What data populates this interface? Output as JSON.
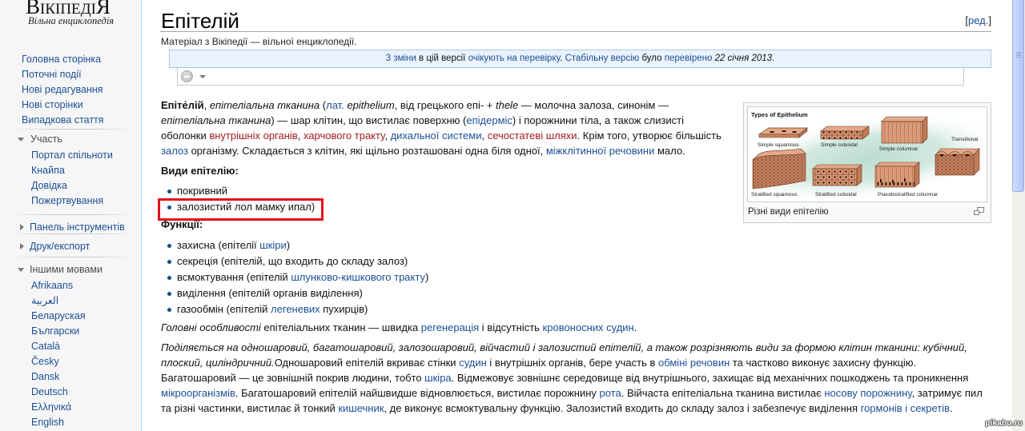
{
  "colors": {
    "link": "#1c4f95",
    "redlink": "#a31c1c",
    "text": "#111111",
    "bullet": "#00528c",
    "annotation": "#e3101b",
    "flagged_bg": "#eaf3fd",
    "flagged_border": "#aac7e6",
    "sidebar_bg": "#f6f6f6"
  },
  "sidebar": {
    "logo": {
      "wordmark": "ВікіпедіЯ",
      "tagline": "Вільна енциклопедія"
    },
    "navigation": [
      "Головна сторінка",
      "Поточні події",
      "Нові редагування",
      "Нові сторінки",
      "Випадкова стаття"
    ],
    "participation": {
      "heading": "Участь",
      "state": "expanded",
      "items": [
        "Портал спільноти",
        "Кнайпа",
        "Довідка",
        "Пожертвування"
      ]
    },
    "toolbox": {
      "heading": "Панель інструментів",
      "state": "collapsed"
    },
    "print": {
      "heading": "Друк/експорт",
      "state": "collapsed"
    },
    "languages": {
      "heading": "Іншими мовами",
      "state": "expanded",
      "items": [
        "Afrikaans",
        "العربية",
        "Беларуская",
        "Български",
        "Català",
        "Česky",
        "Dansk",
        "Deutsch",
        "Ελληνικά",
        "English"
      ]
    }
  },
  "article": {
    "title": "Епітелій",
    "edit_section": {
      "open": "[",
      "label": "ред.",
      "close": "]"
    },
    "site_sub": "Матеріал з Вікіпедії — вільної енциклопедії.",
    "flagged_revs": [
      {
        "type": "link",
        "text": "3 зміни"
      },
      {
        "type": "plain",
        "text": " в цій версії "
      },
      {
        "type": "link",
        "text": "очікують на перевірку"
      },
      {
        "type": "plain",
        "text": ". "
      },
      {
        "type": "link",
        "text": "Стабільну версію"
      },
      {
        "type": "plain",
        "text": " було "
      },
      {
        "type": "link",
        "text": "перевірено"
      },
      {
        "type": "plain",
        "text": " "
      },
      {
        "type": "italic",
        "text": "22 січня 2013"
      },
      {
        "type": "plain",
        "text": "."
      }
    ],
    "feedback_widget": {
      "icons": [
        "disabled-circle-icon",
        "dropdown-arrow-icon"
      ]
    },
    "thumbnail": {
      "caption": "Різні види епітелію",
      "image_title": "Types of Epithelium",
      "labels": {
        "simple_squamous": "Simple squamous",
        "simple_cuboidal": "Simple cuboidal",
        "simple_columnar": "Simple columnar",
        "transitional": "Transitional",
        "stratified_squamous": "Stratified squamous",
        "stratified_cuboidal": "Stratified cuboidal",
        "pseudostratified": "Pseudostratified columnar"
      }
    },
    "intro": [
      {
        "type": "bold",
        "text": "Епіте́лій"
      },
      {
        "type": "plain",
        "text": ", "
      },
      {
        "type": "italic",
        "text": "епітеліальна тканина"
      },
      {
        "type": "plain",
        "text": " ("
      },
      {
        "type": "link",
        "text": "лат."
      },
      {
        "type": "plain",
        "text": " "
      },
      {
        "type": "italic",
        "text": "epithelium"
      },
      {
        "type": "plain",
        "text": ", від грецького епі- + "
      },
      {
        "type": "italic",
        "text": "thele"
      },
      {
        "type": "plain",
        "text": " — молочна залоза, синонім — "
      },
      {
        "type": "italic",
        "text": "епітеліальна тканина"
      },
      {
        "type": "plain",
        "text": ") — шар клітин, що вистилає поверхню ("
      },
      {
        "type": "link",
        "text": "епідерміс"
      },
      {
        "type": "plain",
        "text": ") і порожнини тіла, а також слизисті оболонки "
      },
      {
        "type": "redlink",
        "text": "внутрішніх органів"
      },
      {
        "type": "plain",
        "text": ", "
      },
      {
        "type": "redlink",
        "text": "харчового тракту"
      },
      {
        "type": "plain",
        "text": ", "
      },
      {
        "type": "link",
        "text": "дихальної системи"
      },
      {
        "type": "plain",
        "text": ", "
      },
      {
        "type": "redlink",
        "text": "сечостатеві шляхи"
      },
      {
        "type": "plain",
        "text": ". Крім того, утворює більшість "
      },
      {
        "type": "link",
        "text": "залоз"
      },
      {
        "type": "plain",
        "text": " організму. Складається з клітин, які щільно розташовані одна біля одної, "
      },
      {
        "type": "link",
        "text": "міжклітинної речовини"
      },
      {
        "type": "plain",
        "text": " мало."
      }
    ],
    "types_heading": "Види епітелію:",
    "types": [
      [
        {
          "type": "plain",
          "text": "покривний"
        }
      ],
      [
        {
          "type": "plain",
          "text": "залозистий лол мамку ипал)"
        }
      ]
    ],
    "functions_heading": "Функції:",
    "functions": [
      [
        {
          "type": "plain",
          "text": "захисна (епітелії "
        },
        {
          "type": "link",
          "text": "шкіри"
        },
        {
          "type": "plain",
          "text": ")"
        }
      ],
      [
        {
          "type": "plain",
          "text": "секреція (епітелій, що входить до складу залоз)"
        }
      ],
      [
        {
          "type": "plain",
          "text": "всмоктування (епітелій "
        },
        {
          "type": "link",
          "text": "шлунково-кишкового тракту"
        },
        {
          "type": "plain",
          "text": ")"
        }
      ],
      [
        {
          "type": "plain",
          "text": "виділення (епітелій органів виділення)"
        }
      ],
      [
        {
          "type": "plain",
          "text": "газообмін (епітелій "
        },
        {
          "type": "link",
          "text": "легеневих"
        },
        {
          "type": "plain",
          "text": " пухирців)"
        }
      ]
    ],
    "features": [
      {
        "type": "italic",
        "text": "Головні особливості"
      },
      {
        "type": "plain",
        "text": " епітеліальних тканин — швидка "
      },
      {
        "type": "link",
        "text": "регенерація"
      },
      {
        "type": "plain",
        "text": " і відсутність "
      },
      {
        "type": "link",
        "text": "кровоносних судин"
      },
      {
        "type": "plain",
        "text": "."
      }
    ],
    "layers": [
      {
        "type": "italic",
        "text": "Поділяється на одношаровий, багатошаровий, залозошаровий, війчастий і залозистий епітелій, а також розрізняють види за формою клітин тканини: кубічний, плоский, циліндричний."
      },
      {
        "type": "plain",
        "text": "Одношаровий епітелій вкриває стінки "
      },
      {
        "type": "link",
        "text": "судин"
      },
      {
        "type": "plain",
        "text": " і внутрішніх органів, бере участь в "
      },
      {
        "type": "link",
        "text": "обміні речовин"
      },
      {
        "type": "plain",
        "text": " та частково виконує захисну функцію. Багатошаровий — це зовнішній покрив людини, тобто "
      },
      {
        "type": "link",
        "text": "шкіра"
      },
      {
        "type": "plain",
        "text": ". Відмежовує зовнішнє середовище від внутрішнього, захищає від механічних пошкоджень та проникнення "
      },
      {
        "type": "link",
        "text": "мікроорганізмів"
      },
      {
        "type": "plain",
        "text": ". Багатошаровий епітелій найшвидше відновлюється, вистилає порожнину "
      },
      {
        "type": "link",
        "text": "рота"
      },
      {
        "type": "plain",
        "text": ". Війчаста епітеліальна тканина вистилає "
      },
      {
        "type": "link",
        "text": "носову порожнину"
      },
      {
        "type": "plain",
        "text": ", затримує пил та різні частинки, вистилає й тонкий "
      },
      {
        "type": "link",
        "text": "кишечник"
      },
      {
        "type": "plain",
        "text": ", де виконує всмоктувальну функцію. Залозистий входить до складу залоз і забезпечує виділення "
      },
      {
        "type": "link",
        "text": "гормонів і секретів"
      },
      {
        "type": "plain",
        "text": "."
      }
    ]
  },
  "annotation": {
    "kind": "highlight-box",
    "target": "article.types.1"
  },
  "watermark": "pikabu.ru"
}
